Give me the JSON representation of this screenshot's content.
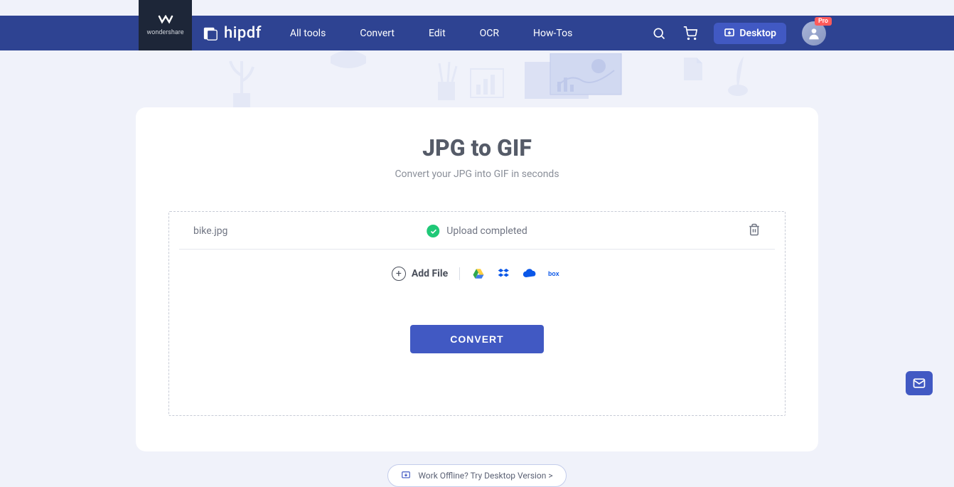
{
  "brand": {
    "parent": "wondershare",
    "product": "hipdf"
  },
  "nav": {
    "items": [
      "All tools",
      "Convert",
      "Edit",
      "OCR",
      "How-Tos"
    ]
  },
  "header": {
    "desktop_label": "Desktop",
    "pro_badge": "Pro"
  },
  "page": {
    "title": "JPG to GIF",
    "subtitle": "Convert your JPG into GIF in seconds"
  },
  "file": {
    "name": "bike.jpg",
    "status": "Upload completed"
  },
  "actions": {
    "add_file": "Add File",
    "convert": "CONVERT",
    "offline": "Work Offline? Try Desktop Version >"
  },
  "cloud_sources": [
    "google-drive",
    "dropbox",
    "onedrive",
    "box"
  ],
  "colors": {
    "primary": "#4159c3",
    "header_bg": "#2e4392",
    "success": "#1fc877"
  }
}
